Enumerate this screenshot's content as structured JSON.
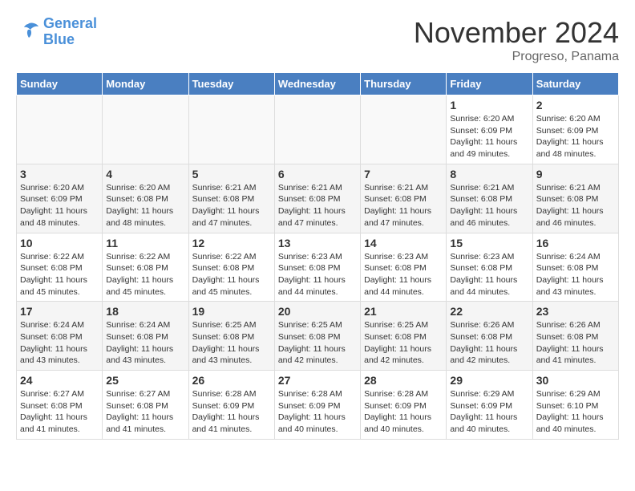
{
  "header": {
    "logo_line1": "General",
    "logo_line2": "Blue",
    "month": "November 2024",
    "location": "Progreso, Panama"
  },
  "days_of_week": [
    "Sunday",
    "Monday",
    "Tuesday",
    "Wednesday",
    "Thursday",
    "Friday",
    "Saturday"
  ],
  "weeks": [
    [
      {
        "num": "",
        "info": ""
      },
      {
        "num": "",
        "info": ""
      },
      {
        "num": "",
        "info": ""
      },
      {
        "num": "",
        "info": ""
      },
      {
        "num": "",
        "info": ""
      },
      {
        "num": "1",
        "info": "Sunrise: 6:20 AM\nSunset: 6:09 PM\nDaylight: 11 hours and 49 minutes."
      },
      {
        "num": "2",
        "info": "Sunrise: 6:20 AM\nSunset: 6:09 PM\nDaylight: 11 hours and 48 minutes."
      }
    ],
    [
      {
        "num": "3",
        "info": "Sunrise: 6:20 AM\nSunset: 6:09 PM\nDaylight: 11 hours and 48 minutes."
      },
      {
        "num": "4",
        "info": "Sunrise: 6:20 AM\nSunset: 6:08 PM\nDaylight: 11 hours and 48 minutes."
      },
      {
        "num": "5",
        "info": "Sunrise: 6:21 AM\nSunset: 6:08 PM\nDaylight: 11 hours and 47 minutes."
      },
      {
        "num": "6",
        "info": "Sunrise: 6:21 AM\nSunset: 6:08 PM\nDaylight: 11 hours and 47 minutes."
      },
      {
        "num": "7",
        "info": "Sunrise: 6:21 AM\nSunset: 6:08 PM\nDaylight: 11 hours and 47 minutes."
      },
      {
        "num": "8",
        "info": "Sunrise: 6:21 AM\nSunset: 6:08 PM\nDaylight: 11 hours and 46 minutes."
      },
      {
        "num": "9",
        "info": "Sunrise: 6:21 AM\nSunset: 6:08 PM\nDaylight: 11 hours and 46 minutes."
      }
    ],
    [
      {
        "num": "10",
        "info": "Sunrise: 6:22 AM\nSunset: 6:08 PM\nDaylight: 11 hours and 45 minutes."
      },
      {
        "num": "11",
        "info": "Sunrise: 6:22 AM\nSunset: 6:08 PM\nDaylight: 11 hours and 45 minutes."
      },
      {
        "num": "12",
        "info": "Sunrise: 6:22 AM\nSunset: 6:08 PM\nDaylight: 11 hours and 45 minutes."
      },
      {
        "num": "13",
        "info": "Sunrise: 6:23 AM\nSunset: 6:08 PM\nDaylight: 11 hours and 44 minutes."
      },
      {
        "num": "14",
        "info": "Sunrise: 6:23 AM\nSunset: 6:08 PM\nDaylight: 11 hours and 44 minutes."
      },
      {
        "num": "15",
        "info": "Sunrise: 6:23 AM\nSunset: 6:08 PM\nDaylight: 11 hours and 44 minutes."
      },
      {
        "num": "16",
        "info": "Sunrise: 6:24 AM\nSunset: 6:08 PM\nDaylight: 11 hours and 43 minutes."
      }
    ],
    [
      {
        "num": "17",
        "info": "Sunrise: 6:24 AM\nSunset: 6:08 PM\nDaylight: 11 hours and 43 minutes."
      },
      {
        "num": "18",
        "info": "Sunrise: 6:24 AM\nSunset: 6:08 PM\nDaylight: 11 hours and 43 minutes."
      },
      {
        "num": "19",
        "info": "Sunrise: 6:25 AM\nSunset: 6:08 PM\nDaylight: 11 hours and 43 minutes."
      },
      {
        "num": "20",
        "info": "Sunrise: 6:25 AM\nSunset: 6:08 PM\nDaylight: 11 hours and 42 minutes."
      },
      {
        "num": "21",
        "info": "Sunrise: 6:25 AM\nSunset: 6:08 PM\nDaylight: 11 hours and 42 minutes."
      },
      {
        "num": "22",
        "info": "Sunrise: 6:26 AM\nSunset: 6:08 PM\nDaylight: 11 hours and 42 minutes."
      },
      {
        "num": "23",
        "info": "Sunrise: 6:26 AM\nSunset: 6:08 PM\nDaylight: 11 hours and 41 minutes."
      }
    ],
    [
      {
        "num": "24",
        "info": "Sunrise: 6:27 AM\nSunset: 6:08 PM\nDaylight: 11 hours and 41 minutes."
      },
      {
        "num": "25",
        "info": "Sunrise: 6:27 AM\nSunset: 6:08 PM\nDaylight: 11 hours and 41 minutes."
      },
      {
        "num": "26",
        "info": "Sunrise: 6:28 AM\nSunset: 6:09 PM\nDaylight: 11 hours and 41 minutes."
      },
      {
        "num": "27",
        "info": "Sunrise: 6:28 AM\nSunset: 6:09 PM\nDaylight: 11 hours and 40 minutes."
      },
      {
        "num": "28",
        "info": "Sunrise: 6:28 AM\nSunset: 6:09 PM\nDaylight: 11 hours and 40 minutes."
      },
      {
        "num": "29",
        "info": "Sunrise: 6:29 AM\nSunset: 6:09 PM\nDaylight: 11 hours and 40 minutes."
      },
      {
        "num": "30",
        "info": "Sunrise: 6:29 AM\nSunset: 6:10 PM\nDaylight: 11 hours and 40 minutes."
      }
    ]
  ]
}
